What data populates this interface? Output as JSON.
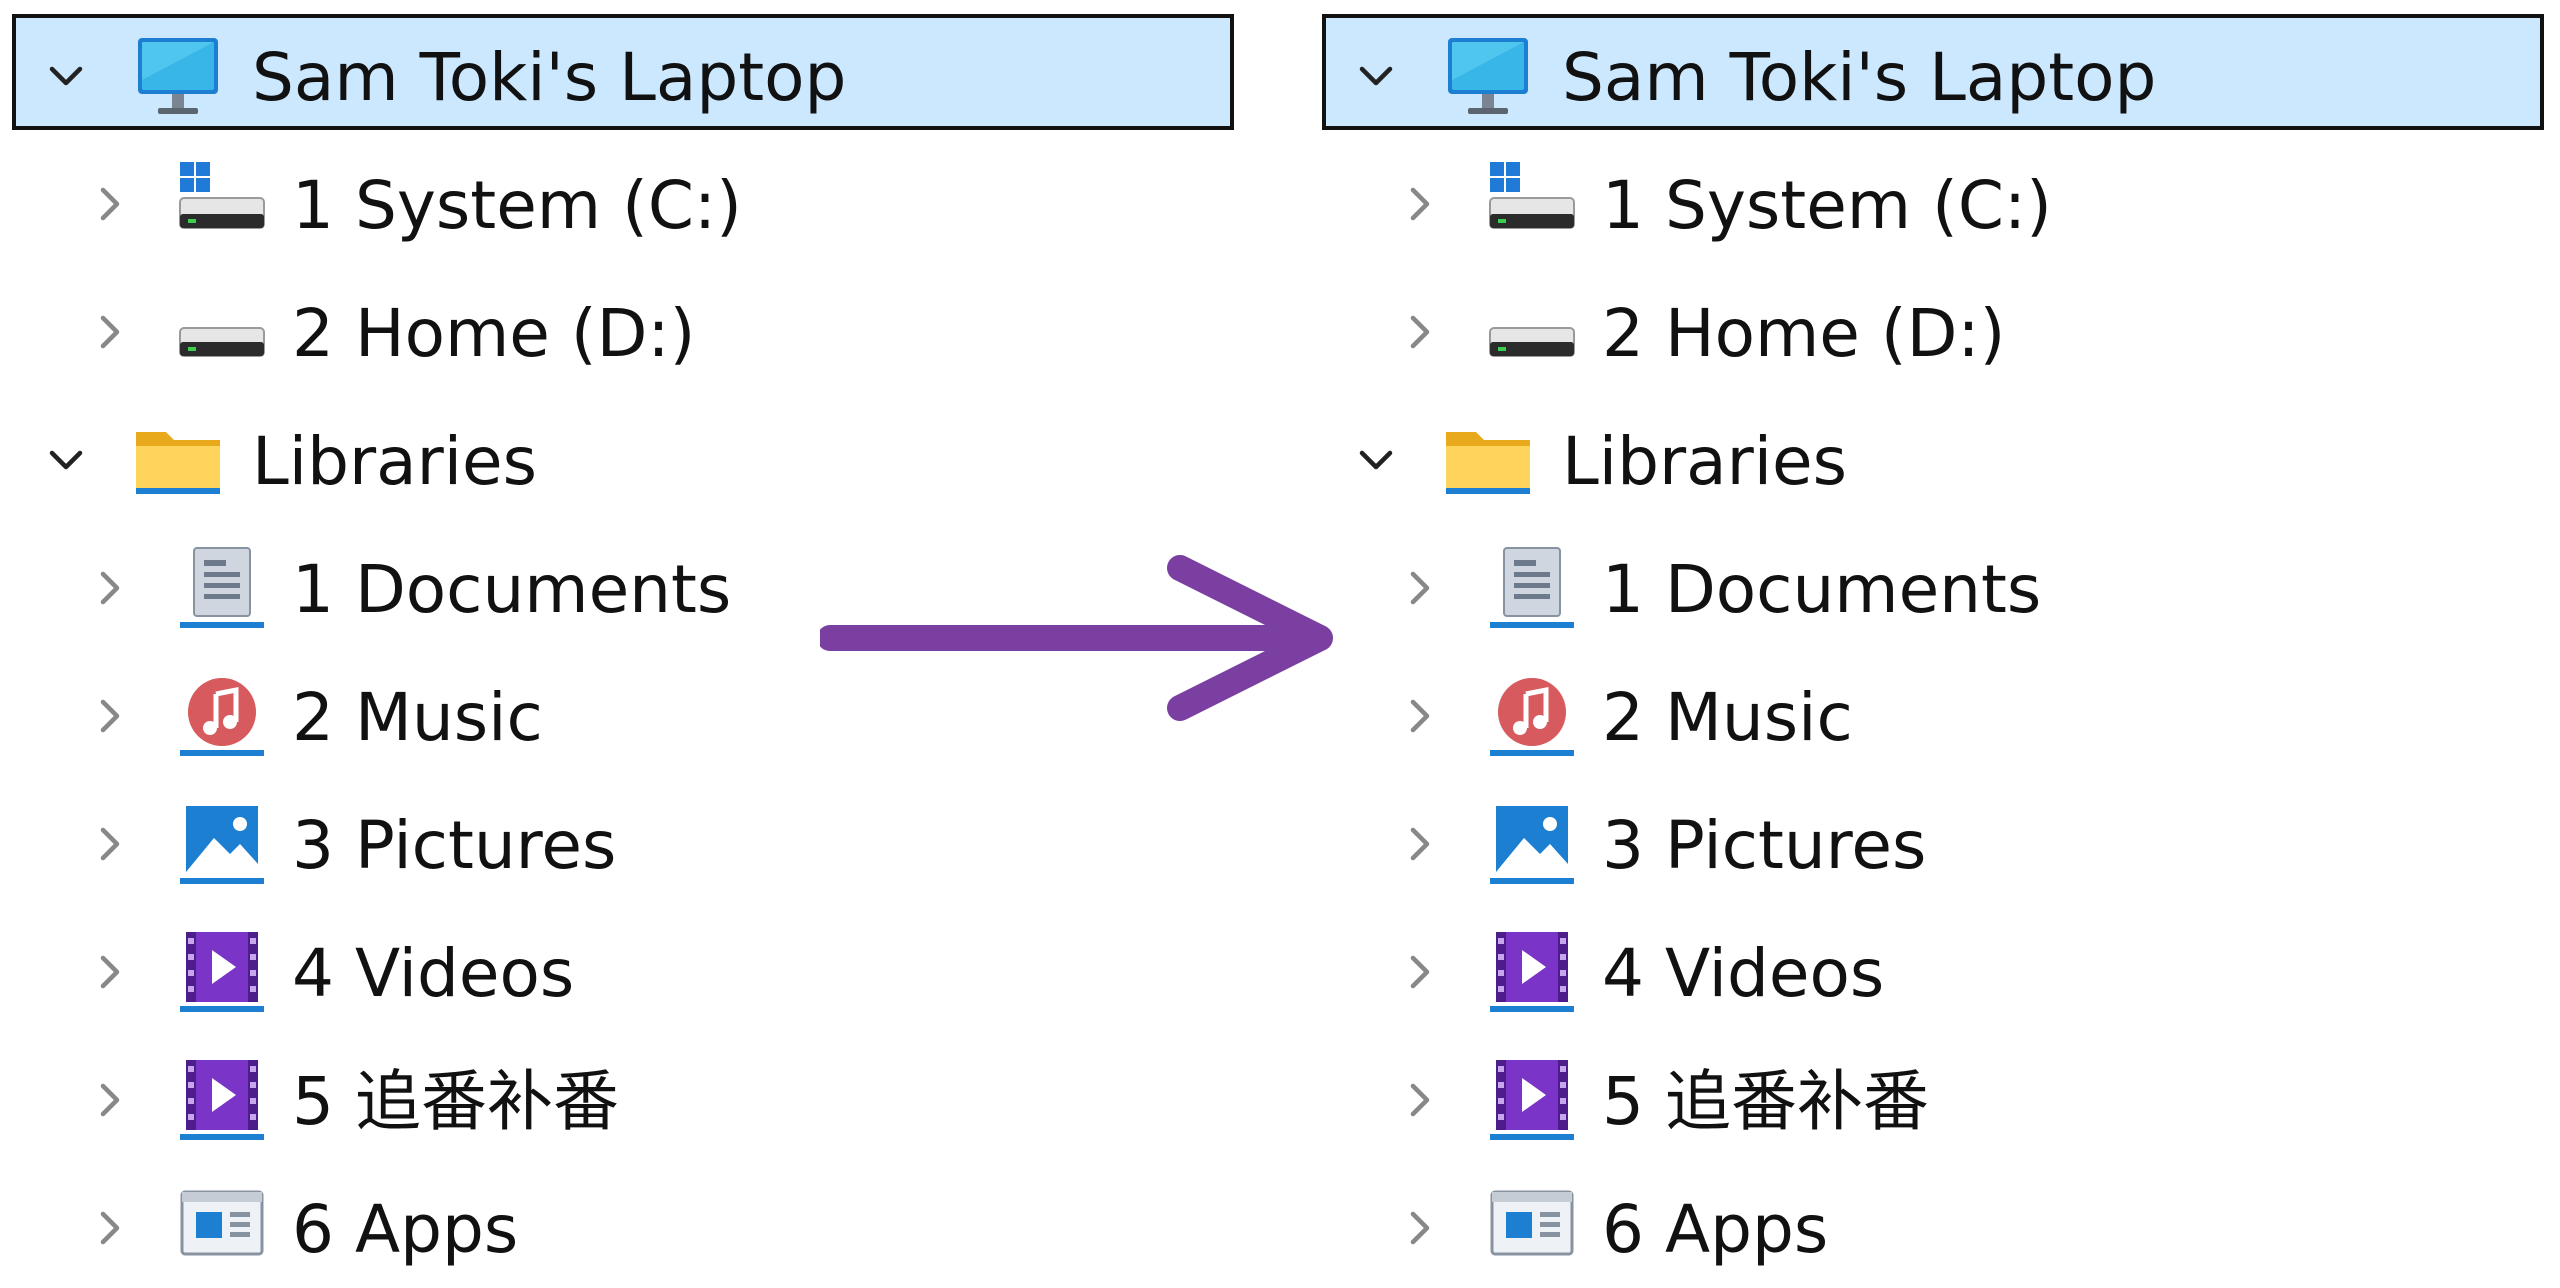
{
  "accent_colors": {
    "selection_fill": "#cce8ff",
    "selection_border": "#111111",
    "arrow": "#7a3fa0"
  },
  "arrow": {
    "icon": "right-arrow-icon"
  },
  "panels": [
    {
      "name": "before",
      "tree": [
        {
          "label": "Sam Toki's Laptop",
          "icon": "computer-icon",
          "expanded": true,
          "selected": true,
          "level": 0
        },
        {
          "label": "1 System (C:)",
          "icon": "system-drive-icon",
          "expanded": false,
          "level": 1
        },
        {
          "label": "2 Home (D:)",
          "icon": "drive-icon",
          "expanded": false,
          "level": 1
        },
        {
          "label": "Libraries",
          "icon": "folder-icon",
          "expanded": true,
          "level": 0
        },
        {
          "label": "1 Documents",
          "icon": "documents-icon",
          "expanded": false,
          "level": 1
        },
        {
          "label": "2 Music",
          "icon": "music-icon",
          "expanded": false,
          "level": 1
        },
        {
          "label": "3 Pictures",
          "icon": "pictures-icon",
          "expanded": false,
          "level": 1
        },
        {
          "label": "4 Videos",
          "icon": "videos-icon",
          "expanded": false,
          "level": 1
        },
        {
          "label": "5 追番补番",
          "icon": "videos-icon",
          "expanded": false,
          "level": 1
        },
        {
          "label": "6 Apps",
          "icon": "apps-icon",
          "expanded": false,
          "level": 1
        }
      ]
    },
    {
      "name": "after",
      "tree": [
        {
          "label": "Sam Toki's Laptop",
          "icon": "computer-icon",
          "expanded": true,
          "selected": true,
          "level": 0
        },
        {
          "label": "1 System (C:)",
          "icon": "system-drive-icon",
          "expanded": false,
          "level": 1
        },
        {
          "label": "2 Home (D:)",
          "icon": "drive-icon",
          "expanded": false,
          "level": 1
        },
        {
          "label": "Libraries",
          "icon": "folder-icon",
          "expanded": true,
          "level": 0
        },
        {
          "label": "1 Documents",
          "icon": "documents-icon",
          "expanded": false,
          "level": 1
        },
        {
          "label": "2 Music",
          "icon": "music-icon",
          "expanded": false,
          "level": 1
        },
        {
          "label": "3 Pictures",
          "icon": "pictures-icon",
          "expanded": false,
          "level": 1
        },
        {
          "label": "4 Videos",
          "icon": "videos-icon",
          "expanded": false,
          "level": 1
        },
        {
          "label": "5 追番补番",
          "icon": "videos-icon",
          "expanded": false,
          "level": 1
        },
        {
          "label": "6 Apps",
          "icon": "apps-icon",
          "expanded": false,
          "level": 1
        }
      ]
    }
  ]
}
